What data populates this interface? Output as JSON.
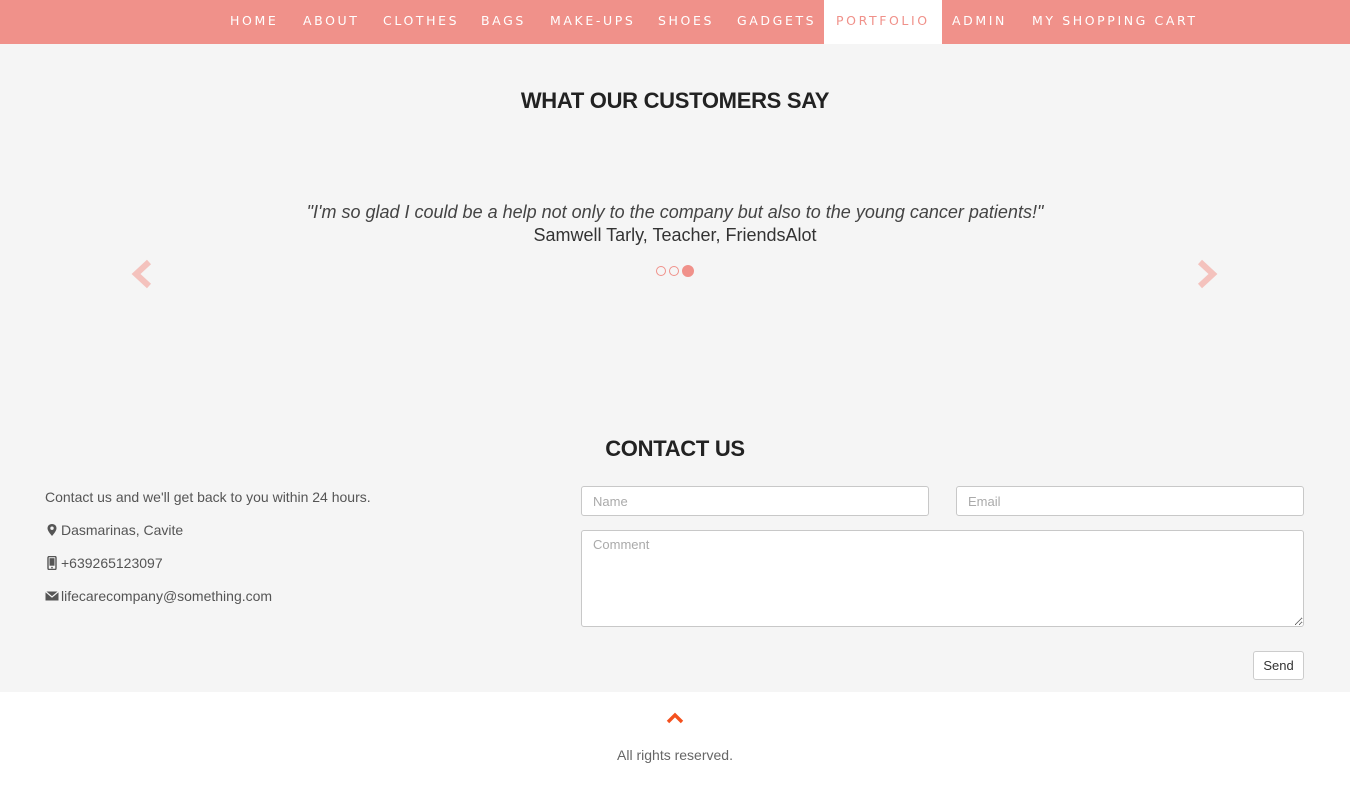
{
  "nav": {
    "items": [
      {
        "label": "HOME"
      },
      {
        "label": "ABOUT"
      },
      {
        "label": "CLOTHES"
      },
      {
        "label": "BAGS"
      },
      {
        "label": "MAKE-UPS"
      },
      {
        "label": "SHOES"
      },
      {
        "label": "GADGETS"
      },
      {
        "label": "PORTFOLIO",
        "active": true
      },
      {
        "label": "ADMIN"
      },
      {
        "label": "MY SHOPPING CART"
      }
    ]
  },
  "testimonials": {
    "title": "WHAT OUR CUSTOMERS SAY",
    "quote": "\"I'm so glad I could be a help not only to the company but also to the young cancer patients!\"",
    "author": "Samwell Tarly, Teacher, FriendsAlot",
    "slide_count": 3,
    "active_slide": 3,
    "prev_icon": "chevron-left-icon",
    "next_icon": "chevron-right-icon"
  },
  "contact": {
    "title": "CONTACT US",
    "intro": "Contact us and we'll get back to you within 24 hours.",
    "location": "Dasmarinas, Cavite",
    "phone": "+639265123097",
    "email": "lifecarecompany@something.com",
    "icons": {
      "location": "map-marker-icon",
      "phone": "phone-icon",
      "email": "envelope-icon"
    },
    "form": {
      "name_placeholder": "Name",
      "email_placeholder": "Email",
      "comment_placeholder": "Comment",
      "send_label": "Send"
    }
  },
  "footer": {
    "text": "All rights reserved.",
    "up_icon": "chevron-up-icon"
  },
  "colors": {
    "accent": "#f0918a",
    "footer_arrow": "#f4511e",
    "background": "#f5f5f5"
  }
}
